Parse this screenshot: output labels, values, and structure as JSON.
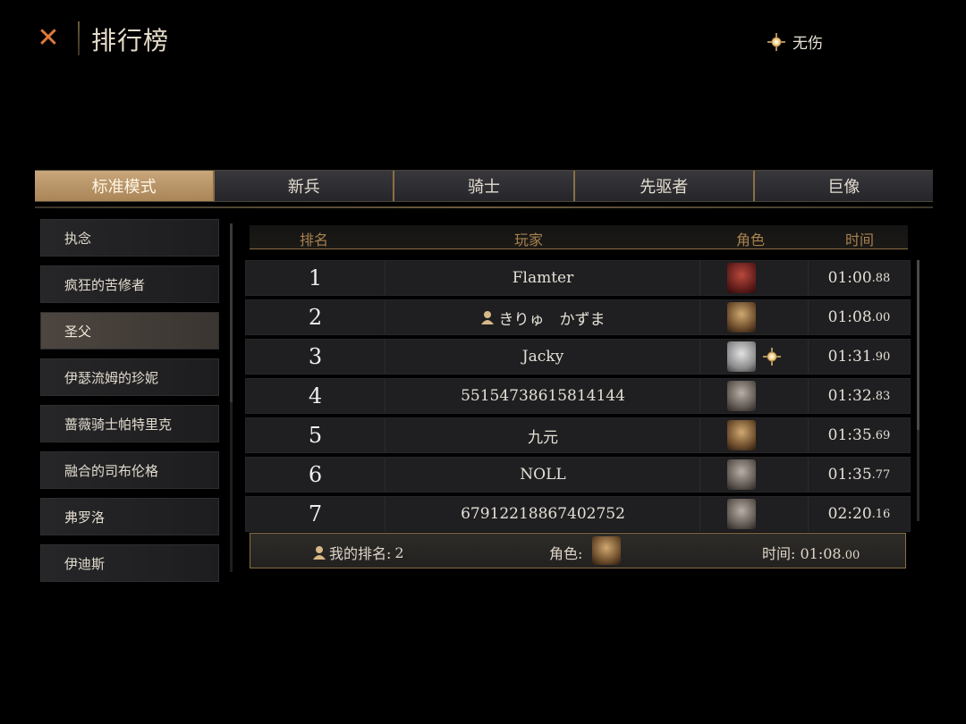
{
  "header": {
    "title": "排行榜",
    "mode_label": "无伤"
  },
  "tabs": [
    {
      "label": "标准模式",
      "active": true
    },
    {
      "label": "新兵",
      "active": false
    },
    {
      "label": "骑士",
      "active": false
    },
    {
      "label": "先驱者",
      "active": false
    },
    {
      "label": "巨像",
      "active": false
    }
  ],
  "sidebar": {
    "items": [
      {
        "label": "执念",
        "active": false
      },
      {
        "label": "疯狂的苦修者",
        "active": false
      },
      {
        "label": "圣父",
        "active": true
      },
      {
        "label": "伊瑟流姆的珍妮",
        "active": false
      },
      {
        "label": "蔷薇骑士帕特里克",
        "active": false
      },
      {
        "label": "融合的司布伦格",
        "active": false
      },
      {
        "label": "弗罗洛",
        "active": false
      },
      {
        "label": "伊迪斯",
        "active": false
      }
    ]
  },
  "table": {
    "columns": {
      "rank": "排名",
      "player": "玩家",
      "role": "角色",
      "time": "时间"
    },
    "rows": [
      {
        "rank": "1",
        "player": "Flamter",
        "self": false,
        "time": "01:00",
        "ms": ".88",
        "portrait": "red-haired-character",
        "no_damage": false
      },
      {
        "rank": "2",
        "player": "きりゅ　かずま",
        "self": true,
        "time": "01:08",
        "ms": ".00",
        "portrait": "blonde-character",
        "no_damage": false
      },
      {
        "rank": "3",
        "player": "Jacky",
        "self": false,
        "time": "01:31",
        "ms": ".90",
        "portrait": "silver-haired-character",
        "no_damage": true
      },
      {
        "rank": "4",
        "player": "55154738615814144",
        "self": false,
        "time": "01:32",
        "ms": ".83",
        "portrait": "grey-haired-character",
        "no_damage": false
      },
      {
        "rank": "5",
        "player": "九元",
        "self": false,
        "time": "01:35",
        "ms": ".69",
        "portrait": "blonde-character",
        "no_damage": false
      },
      {
        "rank": "6",
        "player": "NOLL",
        "self": false,
        "time": "01:35",
        "ms": ".77",
        "portrait": "grey-haired-character",
        "no_damage": false
      },
      {
        "rank": "7",
        "player": "67912218867402752",
        "self": false,
        "time": "02:20",
        "ms": ".16",
        "portrait": "grey-haired-character",
        "no_damage": false
      }
    ]
  },
  "my_rank": {
    "label": "我的排名:",
    "value": "2",
    "role_label": "角色:",
    "time_label": "时间:",
    "time": "01:08",
    "ms": ".00",
    "portrait": "blonde-character"
  },
  "colors": {
    "accent_gold": "#a8814f",
    "tab_active": "#c8a77a",
    "close_orange": "#e07a3a"
  }
}
